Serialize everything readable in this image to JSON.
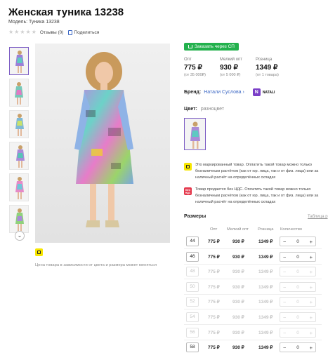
{
  "product": {
    "title": "Женская туника 13238",
    "model": "Модель: Туника 13238",
    "reviews": "Отзывы (0)",
    "share": "Поделиться"
  },
  "sp_button": "Заказать через СП",
  "prices": [
    {
      "label": "Опт",
      "value": "775 ₽",
      "sub": "(от 35 000₽)"
    },
    {
      "label": "Мелкий опт",
      "value": "930 ₽",
      "sub": "(от 5 000 ₽)"
    },
    {
      "label": "Розница",
      "value": "1349 ₽",
      "sub": "(от 1 товара)"
    }
  ],
  "brand": {
    "label": "Бренд:",
    "name": "Натали Суслова ›",
    "logo_text": "NATALI"
  },
  "color": {
    "label": "Цвет:",
    "value": "разноцвет"
  },
  "notices": [
    {
      "icon": "chat-icon",
      "text": "Это маркированный товар. Оплатить такой товар можно только безналичным расчётом (как от юр. лица, так и от физ. лица) или за наличный расчёт на определённых складах"
    },
    {
      "icon": "no-vat-icon",
      "icon_text": "БЕЗ НДС",
      "text": "Товар продается без НДС. Оплатить такой товар можно только безналичным расчётом (как от юр. лица, так и от физ. лица) или за наличный расчёт на определённых складах"
    }
  ],
  "price_note": "Цена товара в зависимости от цвета и размера может меняться",
  "sizes": {
    "title": "Размеры",
    "table_link": "Таблица р",
    "headers": [
      "Опт",
      "Мелкий опт",
      "Розница",
      "Количество"
    ],
    "rows": [
      {
        "size": "44",
        "p1": "775 ₽",
        "p2": "930 ₽",
        "p3": "1349 ₽",
        "qty": "0",
        "available": true
      },
      {
        "size": "46",
        "p1": "775 ₽",
        "p2": "930 ₽",
        "p3": "1349 ₽",
        "qty": "0",
        "available": true
      },
      {
        "size": "48",
        "p1": "775 ₽",
        "p2": "930 ₽",
        "p3": "1349 ₽",
        "qty": "0",
        "available": false
      },
      {
        "size": "50",
        "p1": "775 ₽",
        "p2": "930 ₽",
        "p3": "1349 ₽",
        "qty": "0",
        "available": false
      },
      {
        "size": "52",
        "p1": "775 ₽",
        "p2": "930 ₽",
        "p3": "1349 ₽",
        "qty": "0",
        "available": false
      },
      {
        "size": "54",
        "p1": "775 ₽",
        "p2": "930 ₽",
        "p3": "1349 ₽",
        "qty": "0",
        "available": false
      },
      {
        "size": "56",
        "p1": "775 ₽",
        "p2": "930 ₽",
        "p3": "1349 ₽",
        "qty": "0",
        "available": false
      },
      {
        "size": "58",
        "p1": "775 ₽",
        "p2": "930 ₽",
        "p3": "1349 ₽",
        "qty": "0",
        "available": true
      }
    ]
  },
  "colors": {
    "accent": "#7c5cc4",
    "green": "#23b14d",
    "link": "#3a66c4",
    "red": "#e4364a",
    "yellow": "#f7e600"
  }
}
